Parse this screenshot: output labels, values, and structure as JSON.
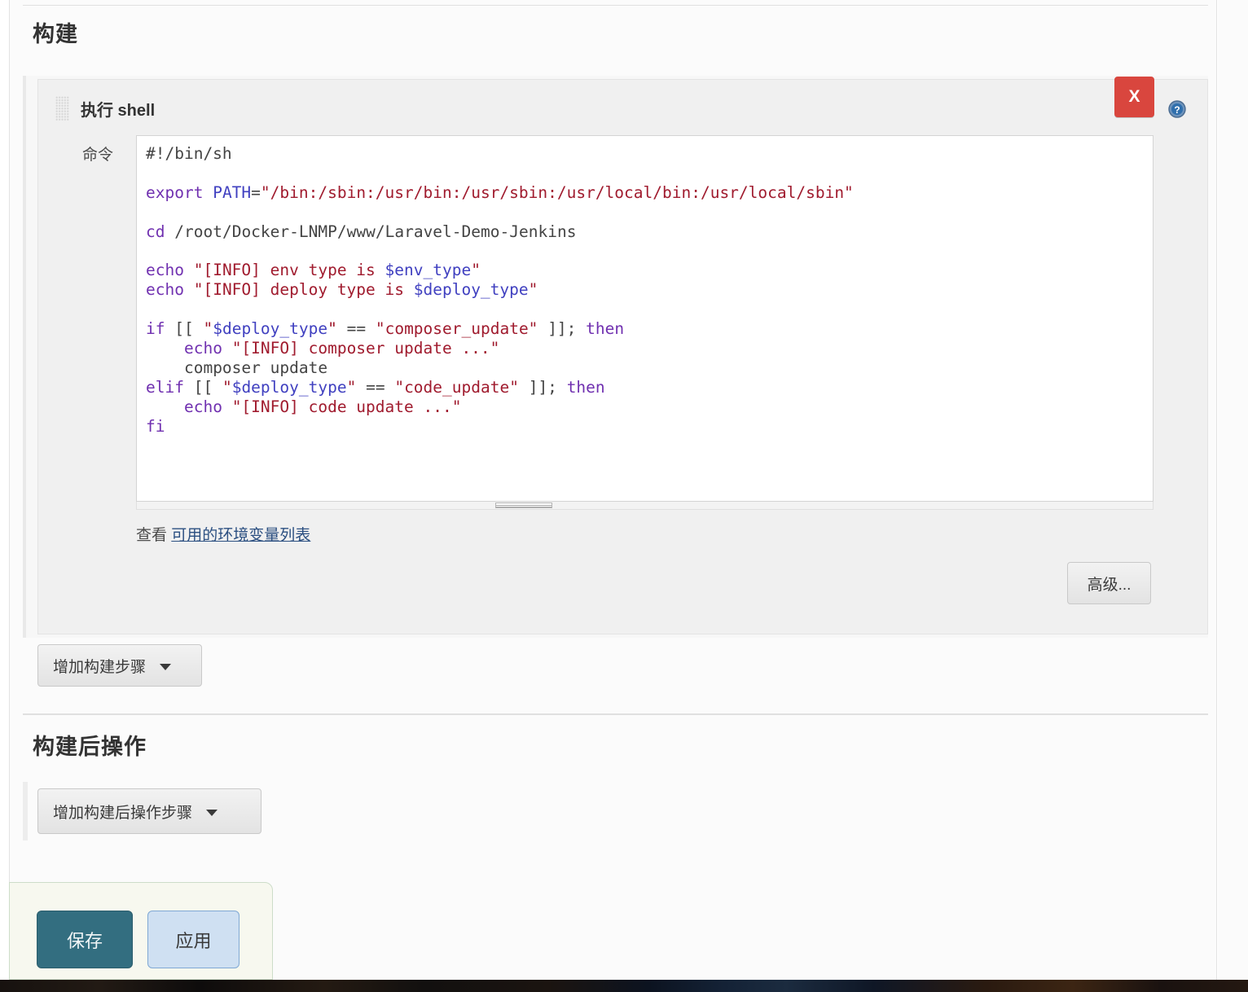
{
  "sections": {
    "build_title": "构建",
    "post_build_title": "构建后操作"
  },
  "build_step": {
    "name": "执行 shell",
    "grip_icon": "drag-grip-icon",
    "delete_label": "X",
    "help_icon": "help-circle-icon",
    "command_label": "命令",
    "command_value": "#!/bin/sh\n\nexport PATH=\"/bin:/sbin:/usr/bin:/usr/sbin:/usr/local/bin:/usr/local/sbin\"\n\ncd /root/Docker-LNMP/www/Laravel-Demo-Jenkins\n\necho \"[INFO] env type is $env_type\"\necho \"[INFO] deploy type is $deploy_type\"\n\nif [[ \"$deploy_type\" == \"composer_update\" ]]; then\n    echo \"[INFO] composer update ...\"\n    composer update\nelif [[ \"$deploy_type\" == \"code_update\" ]]; then\n    echo \"[INFO] code update ...\"\nfi",
    "env_hint_prefix": "查看",
    "env_hint_link": "可用的环境变量列表",
    "advanced_label": "高级..."
  },
  "buttons": {
    "add_build_step": "增加构建步骤",
    "add_post_build_step": "增加构建后操作步骤",
    "save": "保存",
    "apply": "应用"
  },
  "colors": {
    "delete_red": "#d9463e",
    "save_teal": "#336e80",
    "apply_blue": "#cfe0f2",
    "link_blue": "#2b4f81",
    "code_string": "#a01b2e",
    "code_keyword": "#7030b0",
    "code_variable": "#4040c0"
  }
}
